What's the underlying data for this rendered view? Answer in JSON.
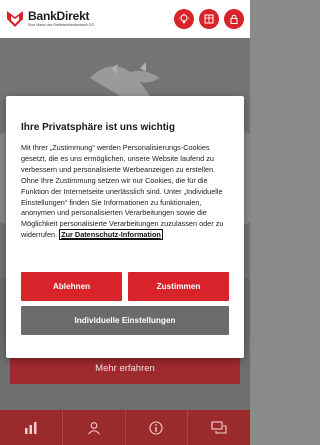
{
  "brand": {
    "name": "BankDirekt",
    "tagline": "Eine Marke der Raiffeisenlandesbank OÖ"
  },
  "header_icons": [
    "lightbulb-icon",
    "apps-icon",
    "lock-icon"
  ],
  "hero": {
    "cta_label": "Mehr erfahren"
  },
  "bottom_nav": [
    "chart-icon",
    "user-icon",
    "info-icon",
    "chat-icon"
  ],
  "consent": {
    "title": "Ihre Privatsphäre ist uns wichtig",
    "body": "Mit Ihrer „Zustimmung“ werden Personalisierungs-Cookies gesetzt, die es uns ermöglichen, unsere Website laufend zu verbessern und personalisierte Werbeanzeigen zu erstellen. Ohne Ihre Zustimmung setzen wir nur Cookies, die für die Funktion der Internetseite unerlässlich sind. Unter „Individuelle Einstellungen“ finden Sie Informationen zu funktionalen, anonymen und personalisierten Verarbeitungen sowie die Möglichkeit personalisierte Verarbeitungen zuzulassen oder zu widerrufen.",
    "link": "Zur Datenschutz-Information",
    "reject_label": "Ablehnen",
    "accept_label": "Zustimmen",
    "settings_label": "Individuelle Einstellungen"
  },
  "colors": {
    "brand_red": "#d9232a",
    "gray_button": "#6b6b6b"
  }
}
